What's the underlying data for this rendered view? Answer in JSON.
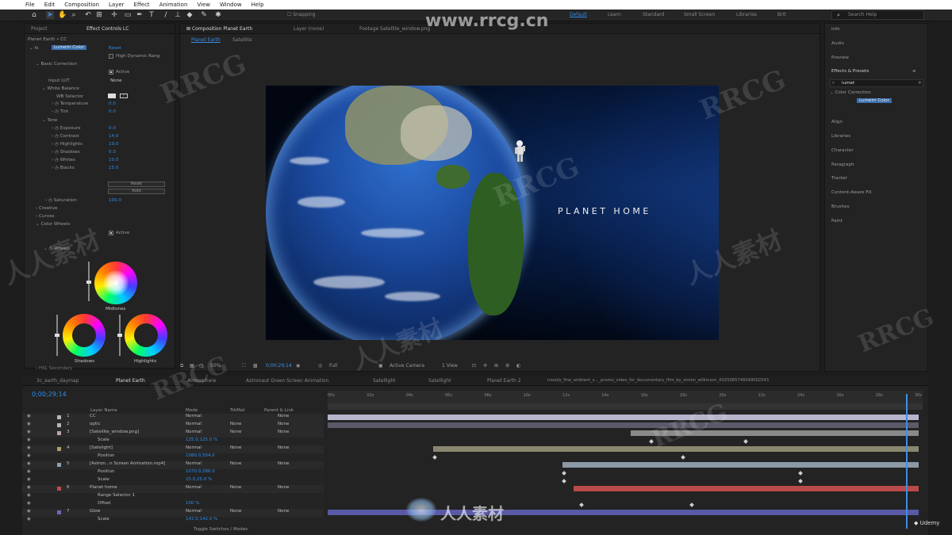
{
  "menu": [
    "File",
    "Edit",
    "Composition",
    "Layer",
    "Effect",
    "Animation",
    "View",
    "Window",
    "Help"
  ],
  "toolbar": {
    "snapping": "Snapping",
    "workspaces": [
      "Default",
      "Learn",
      "Standard",
      "Small Screen",
      "Libraries",
      "Brit"
    ],
    "active_workspace": "Default",
    "search_placeholder": "Search Help"
  },
  "left_panel": {
    "tabs": [
      "Project",
      "Effect Controls LC"
    ],
    "layer_path": "Planet Earth • CC",
    "effect_name": "Lumetri Color",
    "reset": "Reset",
    "hdr": "High Dynamic Rang",
    "basic": "Basic Correction",
    "active": "Active",
    "input_lut": "Input LUT",
    "input_lut_val": "None",
    "white_balance": "White Balance",
    "wb_selector": "WB Selector",
    "temperature": "Temperature",
    "temperature_val": "0.0",
    "tint": "Tint",
    "tint_val": "0.0",
    "tone": "Tone",
    "exposure": "Exposure",
    "exposure_val": "0.0",
    "contrast": "Contrast",
    "contrast_val": "14.0",
    "highlights": "Highlights",
    "highlights_val": "19.0",
    "shadows": "Shadows",
    "shadows_val": "0.0",
    "whites": "Whites",
    "whites_val": "10.0",
    "blacks": "Blacks",
    "blacks_val": "15.0",
    "reset_btn": "Reset",
    "auto_btn": "Auto",
    "saturation": "Saturation",
    "saturation_val": "100.0",
    "creative": "Creative",
    "curves": "Curves",
    "color_wheels": "Color Wheels",
    "active2": "Active",
    "wheels": "Wheels",
    "midtones": "Midtones",
    "shadows_w": "Shadows",
    "highlights_w": "Highlights",
    "hsl": "HSL Secondary"
  },
  "comp_panel": {
    "tabs": [
      "Composition Planet Earth",
      "Layer (none)",
      "Footage Satellite_window.png"
    ],
    "subtabs": [
      "Planet Earth",
      "Satellite"
    ],
    "title_text": "PLANET HOME",
    "viewer_ctrl": [
      "50%",
      "0;00;29;14",
      "Full",
      "Active Camera",
      "1 View"
    ]
  },
  "right_panel": {
    "items": [
      "Info",
      "Audio",
      "Preview",
      "Effects & Presets"
    ],
    "search_value": "lumet",
    "category": "Color Correction",
    "effect": "Lumetri Color",
    "more": [
      "Align",
      "Libraries",
      "Character",
      "Paragraph",
      "Tracker",
      "Content-Aware Fill",
      "Brushes",
      "Paint"
    ]
  },
  "timeline": {
    "tabs": [
      "3c_earth_daymap",
      "Planet Earth",
      "Atmosphere",
      "Astronaut Green Screen Animation",
      "Satellight",
      "Satellight",
      "Planet Earth 2",
      "moody_fine_ambient_s..._promo_video_for_documentary_film_by_simon_wilkinson_X025085746049002543"
    ],
    "timecode": "0;00;29;14",
    "headers": {
      "layer_name": "Layer Name",
      "mode": "Mode",
      "trkmat": "TrkMat",
      "parent": "Parent & Link"
    },
    "ruler": [
      "00s",
      "02s",
      "04s",
      "06s",
      "08s",
      "10s",
      "12s",
      "14s",
      "16s",
      "18s",
      "20s",
      "22s",
      "24s",
      "26s",
      "28s",
      "30s"
    ],
    "layers": [
      {
        "n": "1",
        "name": "CC",
        "mode": "Normal",
        "trk": "",
        "parent": "None",
        "color": "#b7b7b7"
      },
      {
        "n": "2",
        "name": "optic",
        "mode": "Normal",
        "trk": "None",
        "parent": "None",
        "color": "#b7b7b7"
      },
      {
        "n": "3",
        "name": "[Satellite_window.png]",
        "mode": "Normal",
        "trk": "None",
        "parent": "None",
        "color": "#c0a0a0"
      },
      {
        "n": "",
        "name": "Scale",
        "mode": "125.0,125.0 %",
        "trk": "",
        "parent": "",
        "color": ""
      },
      {
        "n": "4",
        "name": "[Satelight]",
        "mode": "Normal",
        "trk": "None",
        "parent": "None",
        "color": "#a9a06e"
      },
      {
        "n": "",
        "name": "Position",
        "mode": "1080.0,554.0",
        "trk": "",
        "parent": "",
        "color": ""
      },
      {
        "n": "5",
        "name": "[Astron...n Screen Animation.mp4]",
        "mode": "Normal",
        "trk": "None",
        "parent": "None",
        "color": "#8ca0b0"
      },
      {
        "n": "",
        "name": "Position",
        "mode": "1070.0,286.0",
        "trk": "",
        "parent": "",
        "color": ""
      },
      {
        "n": "",
        "name": "Scale",
        "mode": "25.0,25.0 %",
        "trk": "",
        "parent": "",
        "color": ""
      },
      {
        "n": "6",
        "name": "Planet home",
        "mode": "Normal",
        "trk": "None",
        "parent": "None",
        "color": "#c04a4a"
      },
      {
        "n": "",
        "name": "Range Selector 1",
        "mode": "",
        "trk": "",
        "parent": "",
        "color": ""
      },
      {
        "n": "",
        "name": "Offset",
        "mode": "100 %",
        "trk": "",
        "parent": "",
        "color": ""
      },
      {
        "n": "7",
        "name": "Glow",
        "mode": "Normal",
        "trk": "None",
        "parent": "None",
        "color": "#6a6ab8"
      },
      {
        "n": "",
        "name": "Scale",
        "mode": "142.0,142.0 %",
        "trk": "",
        "parent": "",
        "color": ""
      }
    ],
    "toggle": "Toggle Switches / Modes"
  },
  "watermarks": {
    "site": "www.rrcg.cn",
    "brand": "RRCG",
    "cn": "人人素材"
  },
  "udemy": "Udemy"
}
